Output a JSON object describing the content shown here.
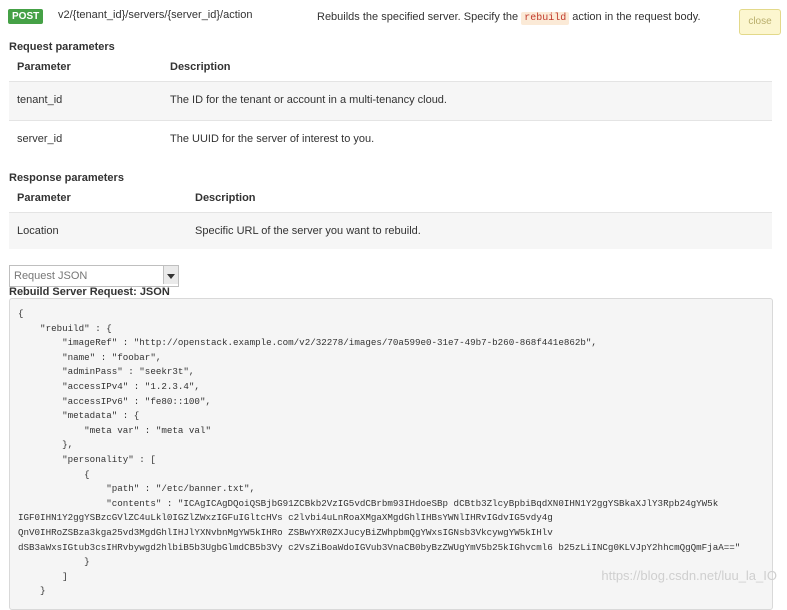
{
  "method": "POST",
  "path": "v2/{tenant_id}/servers/{server_id}/action",
  "summary": {
    "before": "Rebuilds the specified server. Specify the ",
    "code": "rebuild",
    "after": " action in the request body."
  },
  "close_label": "close",
  "request": {
    "title": "Request parameters",
    "col_param": "Parameter",
    "col_desc": "Description",
    "rows": [
      {
        "param": "tenant_id",
        "desc": "The ID for the tenant or account in a multi-tenancy cloud."
      },
      {
        "param": "server_id",
        "desc": "The UUID for the server of interest to you."
      }
    ]
  },
  "response": {
    "title": "Response parameters",
    "col_param": "Parameter",
    "col_desc": "Description",
    "rows": [
      {
        "param": "Location",
        "desc": "Specific URL of the server you want to rebuild."
      }
    ]
  },
  "select": {
    "value": "Request JSON"
  },
  "code_title": "Rebuild Server Request: JSON",
  "code_lines": [
    "{",
    "    \"rebuild\" : {",
    "        \"imageRef\" : \"http://openstack.example.com/v2/32278/images/70a599e0-31e7-49b7-b260-868f441e862b\",",
    "        \"name\" : \"foobar\",",
    "        \"adminPass\" : \"seekr3t\",",
    "        \"accessIPv4\" : \"1.2.3.4\",",
    "        \"accessIPv6\" : \"fe80::100\",",
    "        \"metadata\" : {",
    "            \"meta var\" : \"meta val\"",
    "        },",
    "        \"personality\" : [",
    "            {",
    "                \"path\" : \"/etc/banner.txt\",",
    "                \"contents\" : \"ICAgICAgDQoiQSBjbG91ZCBkb2VzIG5vdCBrbm93IHdoeSBp dCBtb3ZlcyBpbiBqdXN0IHN1Y2ggYSBkaXJlY3Rpb24gYW5k",
    "IGF0IHN1Y2ggYSBzcGVlZC4uLkl0IGZlZWxzIGFuIGltcHVs c2lvbi4uLnRoaXMgaXMgdGhlIHBsYWNlIHRvIGdvIG5vdy4g",
    "QnV0IHRoZSBza3kga25vd3MgdGhlIHJlYXNvbnMgYW5kIHRo ZSBwYXR0ZXJucyBiZWhpbmQgYWxsIGNsb3VkcywgYW5kIHlv",
    "dSB3aWxsIGtub3csIHRvbywgd2hlbiB5b3UgbGlmdCB5b3Vy c2VsZiBoaWdoIGVub3VnaCB0byBzZWUgYmV5b25kIGhvcml6 b25zLiINCg0KLVJpY2hhcmQgQmFjaA==\"",
    "            }",
    "        ]",
    "    }"
  ],
  "watermark": "https://blog.csdn.net/luu_la_IO"
}
